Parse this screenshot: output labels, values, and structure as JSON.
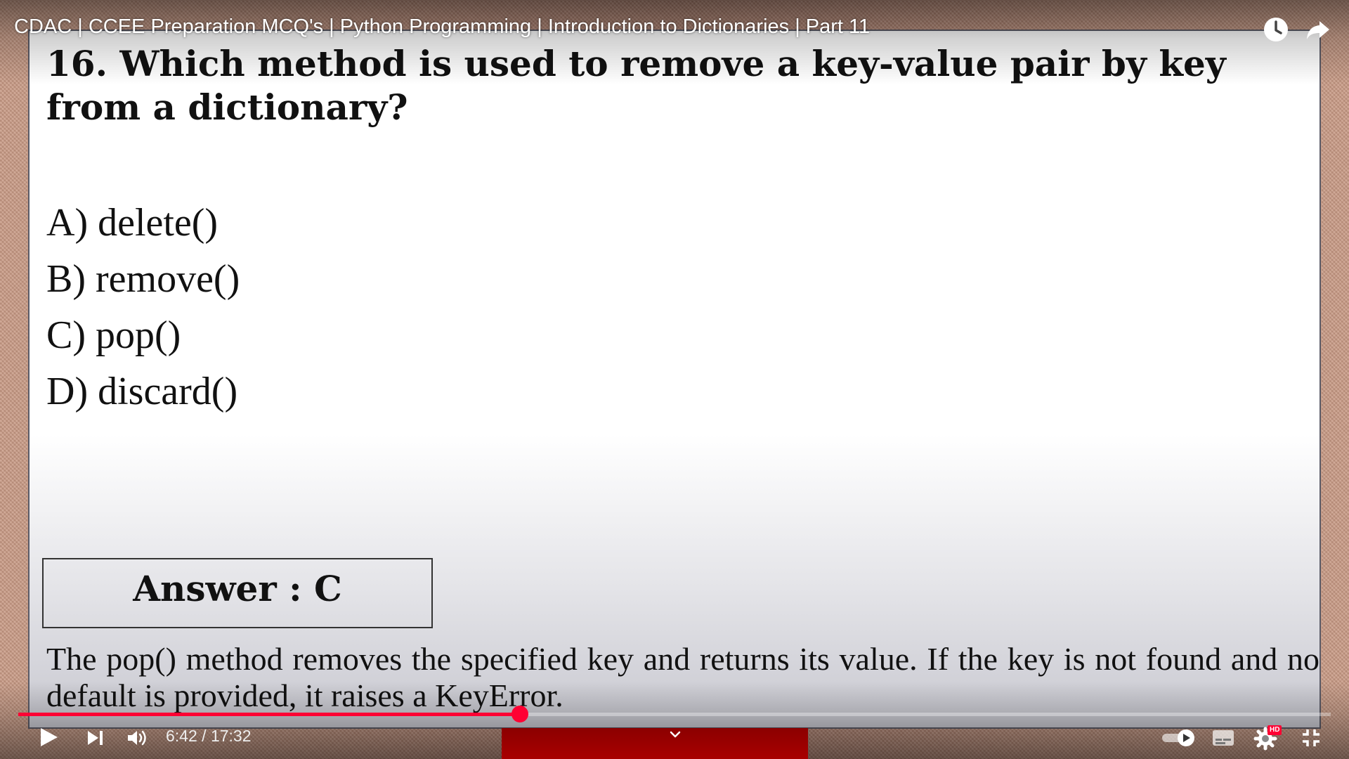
{
  "video": {
    "title": "CDAC | CCEE Preparation MCQ's | Python Programming | Introduction to Dictionaries | Part 11",
    "current_time": "6:42",
    "duration": "17:32",
    "progress_fraction": 0.382,
    "hd_badge": "HD",
    "accent_color": "#ff0033"
  },
  "slide": {
    "question": "16. Which method is used to remove a key-value pair by key from a dictionary?",
    "options": [
      "A) delete()",
      "B) remove()",
      "C) pop()",
      "D) discard()"
    ],
    "answer": "Answer : C",
    "explanation": "The pop() method removes the specified key and returns its value. If the key is not found and no default is provided, it raises a KeyError."
  },
  "icons": {
    "top_right": [
      "clock-icon",
      "share-icon"
    ],
    "bottom_left": [
      "play-icon",
      "next-icon",
      "volume-icon"
    ],
    "bottom_right": [
      "autoplay-toggle-icon",
      "subtitles-icon",
      "settings-icon",
      "exit-fullscreen-icon"
    ]
  }
}
